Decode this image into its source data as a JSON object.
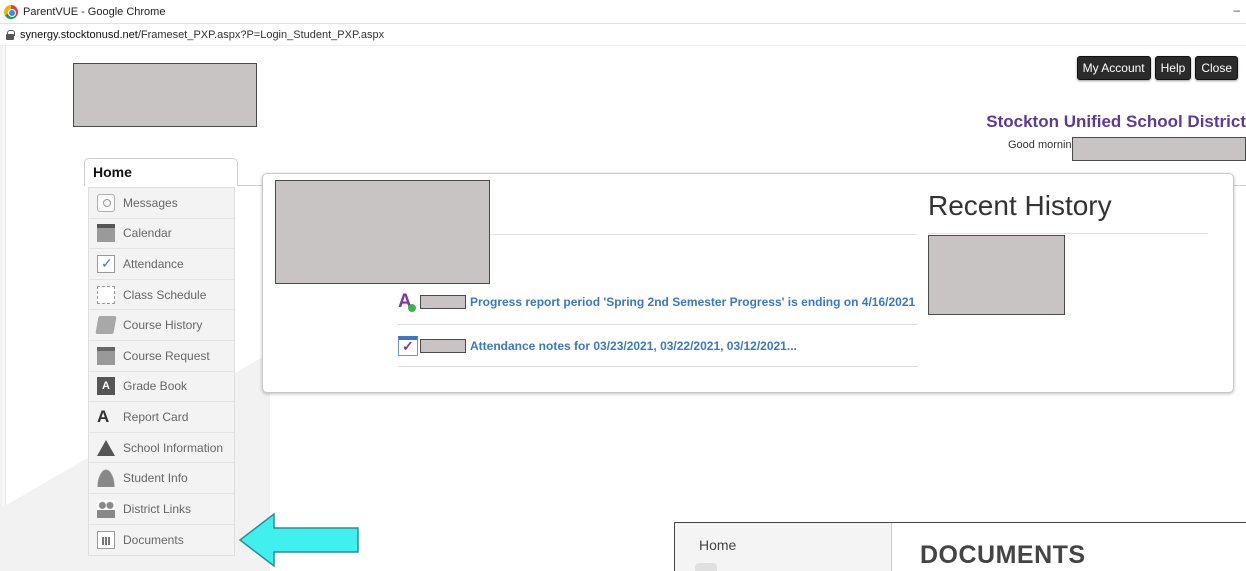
{
  "browser": {
    "window_title": "ParentVUE - Google Chrome",
    "url_host": "synergy.stocktonusd.net",
    "url_path": "/Frameset_PXP.aspx?P=Login_Student_PXP.aspx",
    "minimize_glyph": "–"
  },
  "header": {
    "buttons": [
      "My Account",
      "Help",
      "Close"
    ],
    "district_name": "Stockton Unified School District",
    "greeting": "Good morning,"
  },
  "tabs": {
    "home": "Home"
  },
  "menu": {
    "items": [
      {
        "label": "Messages",
        "icon": "messages-icon"
      },
      {
        "label": "Calendar",
        "icon": "calendar-icon"
      },
      {
        "label": "Attendance",
        "icon": "attendance-icon"
      },
      {
        "label": "Class Schedule",
        "icon": "class-schedule-icon"
      },
      {
        "label": "Course History",
        "icon": "course-history-icon"
      },
      {
        "label": "Course Request",
        "icon": "course-request-icon"
      },
      {
        "label": "Grade Book",
        "icon": "grade-book-icon"
      },
      {
        "label": "Report Card",
        "icon": "report-card-icon"
      },
      {
        "label": "School Information",
        "icon": "school-information-icon"
      },
      {
        "label": "Student Info",
        "icon": "student-info-icon"
      },
      {
        "label": "District Links",
        "icon": "district-links-icon"
      },
      {
        "label": "Documents",
        "icon": "documents-icon"
      }
    ],
    "gradebook_glyph": "A",
    "reportcard_glyph": "A"
  },
  "main": {
    "recent_history_title": "Recent History",
    "notices": [
      {
        "text": "Progress report period 'Spring 2nd Semester Progress' is ending on 4/16/2021",
        "icon": "report-card-icon"
      },
      {
        "text": "Attendance notes for 03/23/2021, 03/22/2021, 03/12/2021...",
        "icon": "attendance-check-icon"
      }
    ],
    "aplus_glyph": "A"
  },
  "inset": {
    "home_label": "Home",
    "title": "DOCUMENTS"
  },
  "colors": {
    "district_purple": "#5b3aa0",
    "link_blue": "#3a78c4",
    "arrow_cyan": "#3ff0ee",
    "button_dark": "#2b2b2b",
    "redaction_gray": "#c8c4c4"
  }
}
